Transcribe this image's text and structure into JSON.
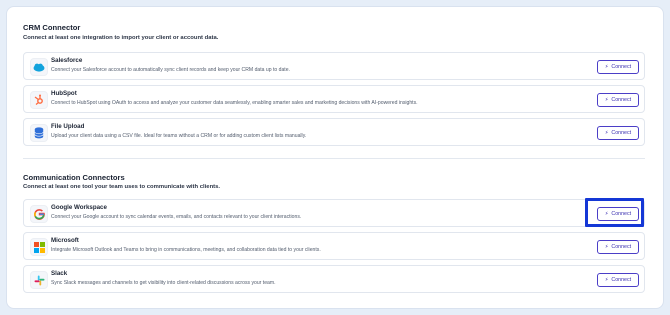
{
  "crm": {
    "title": "CRM Connector",
    "subtitle": "Connect at least one integration to import your client or account data.",
    "items": [
      {
        "name": "Salesforce",
        "desc": "Connect your Salesforce account to automatically sync client records and keep your CRM data up to date.",
        "icon": "salesforce-cloud-icon",
        "button": "Connect"
      },
      {
        "name": "HubSpot",
        "desc": "Connect to HubSpot using OAuth to access and analyze your customer data seamlessly, enabling smarter sales and marketing decisions with AI-powered insights.",
        "icon": "hubspot-icon",
        "button": "Connect"
      },
      {
        "name": "File Upload",
        "desc": "Upload your client data using a CSV file. Ideal for teams without a CRM or for adding custom client lists manually.",
        "icon": "database-icon",
        "button": "Connect"
      }
    ]
  },
  "comm": {
    "title": "Communication Connectors",
    "subtitle": "Connect at least one tool your team uses to communicate with clients.",
    "items": [
      {
        "name": "Google Workspace",
        "desc": "Connect your Google account to sync calendar events, emails, and contacts relevant to your client interactions.",
        "icon": "google-icon",
        "button": "Connect"
      },
      {
        "name": "Microsoft",
        "desc": "Integrate Microsoft Outlook and Teams to bring in communications, meetings, and collaboration data tied to your clients.",
        "icon": "microsoft-icon",
        "button": "Connect"
      },
      {
        "name": "Slack",
        "desc": "Sync Slack messages and channels to get visibility into client-related discussions across your team.",
        "icon": "slack-icon",
        "button": "Connect"
      }
    ]
  },
  "colors": {
    "accent": "#4b3ec7",
    "highlight": "#1437d6",
    "background": "#e6eef8"
  }
}
